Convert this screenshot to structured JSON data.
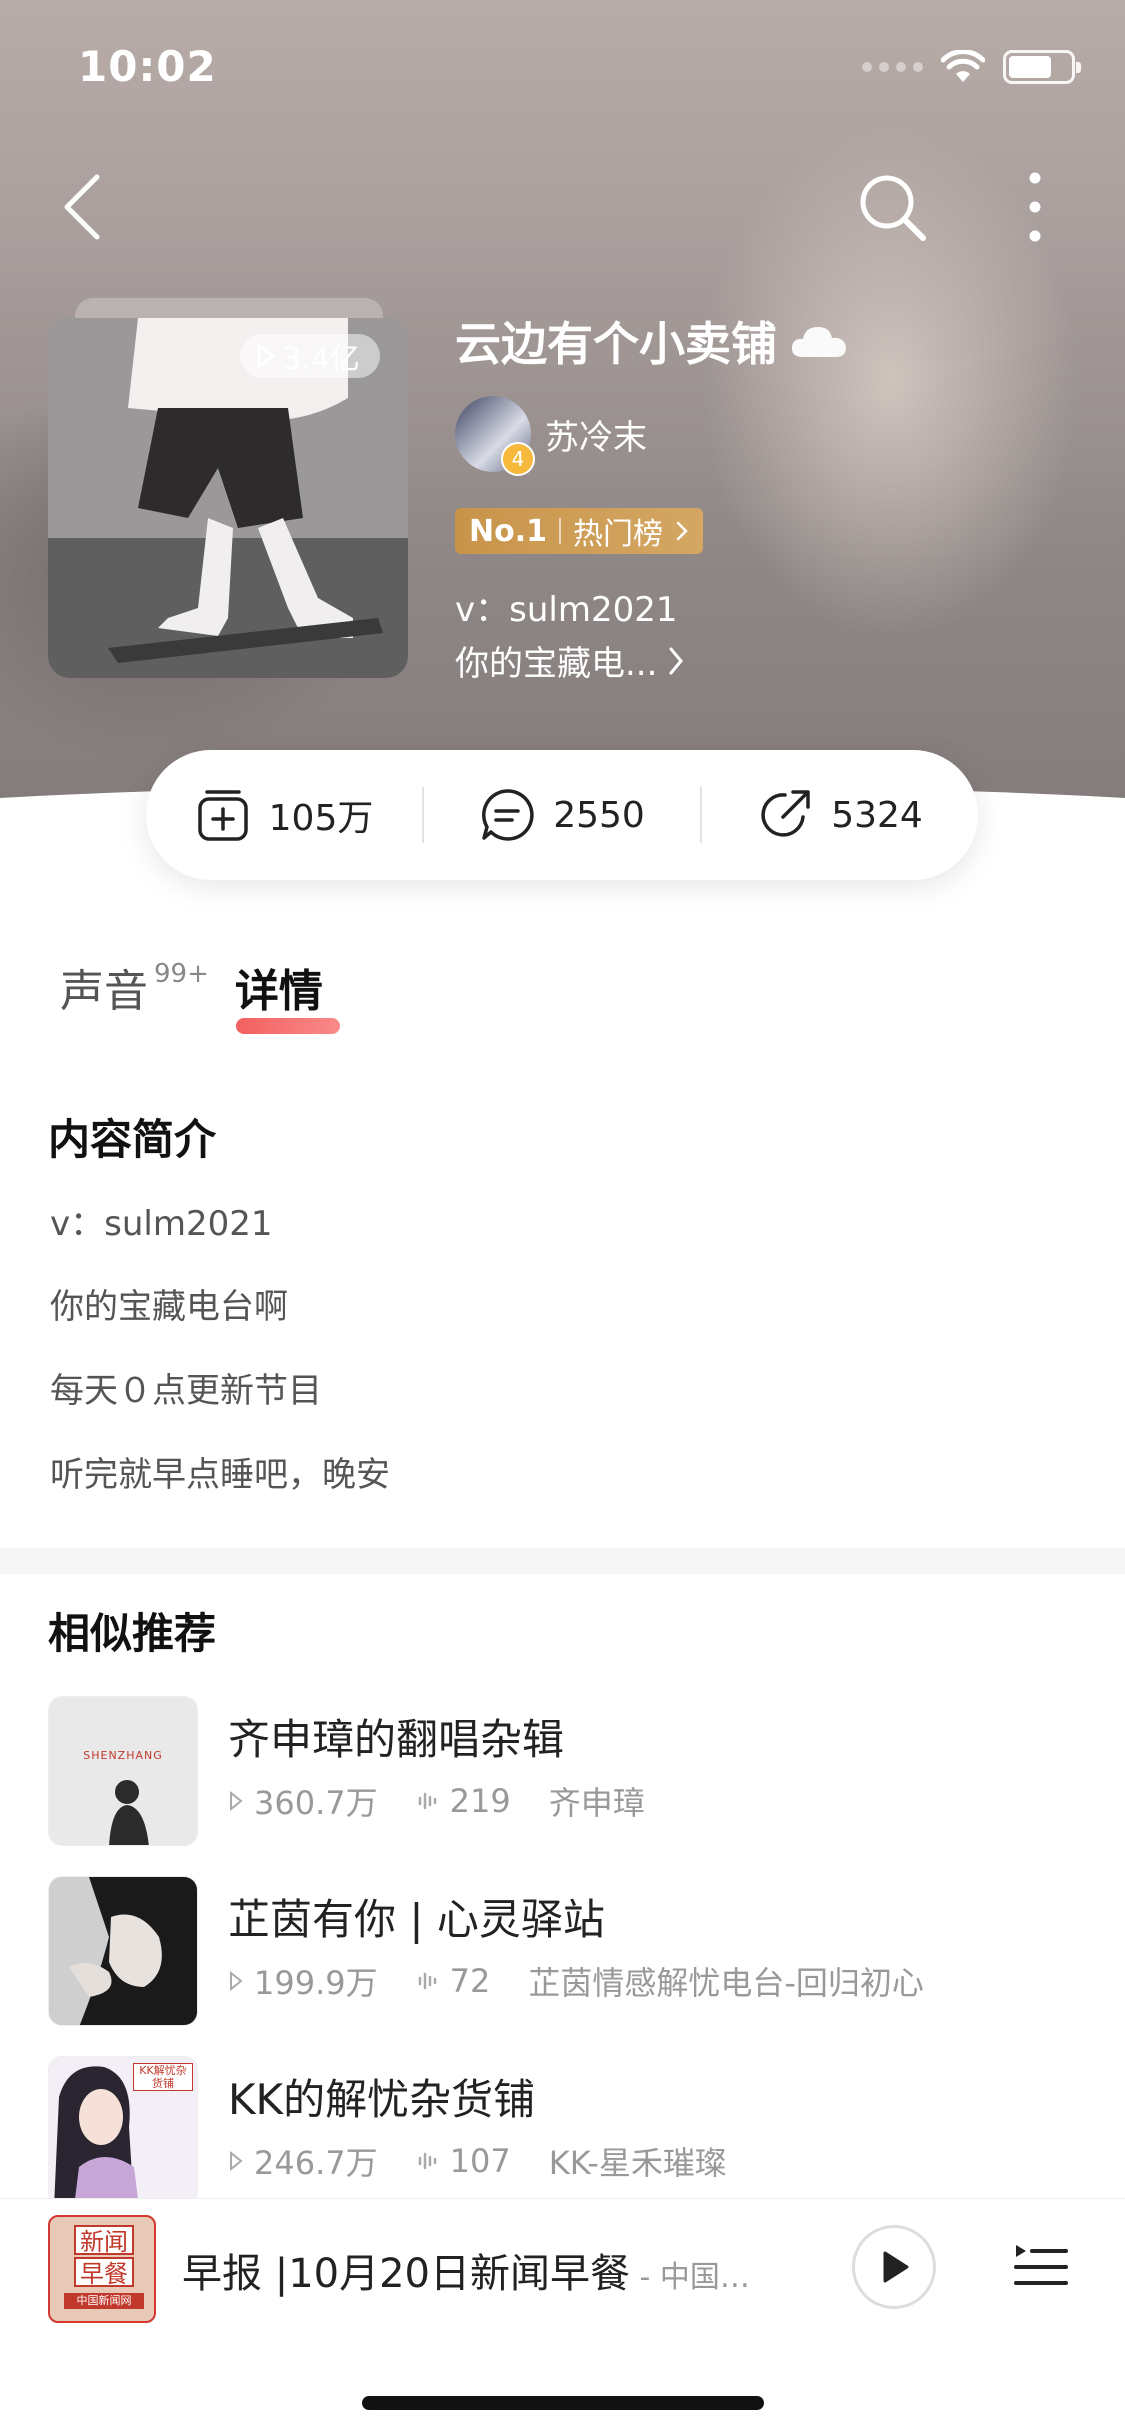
{
  "status_bar": {
    "time": "10:02"
  },
  "album": {
    "title": "云边有个小卖铺",
    "play_count": "3.4亿",
    "author": "苏冷末",
    "author_level": "4",
    "rank_label": "No.1",
    "rank_board": "热门榜",
    "desc_line1": "v：sulm2021",
    "desc_line2": "你的宝藏电..."
  },
  "actions": {
    "subscribe_count": "105万",
    "comment_count": "2550",
    "share_count": "5324"
  },
  "tabs": [
    {
      "label": "声音",
      "count": "99+"
    },
    {
      "label": "详情"
    }
  ],
  "intro": {
    "title": "内容简介",
    "lines": [
      "v：sulm2021",
      "你的宝藏电台啊",
      "每天０点更新节目",
      "听完就早点睡吧，晚安"
    ]
  },
  "recommendations": {
    "title": "相似推荐",
    "items": [
      {
        "title": "齐申璋的翻唱杂辑",
        "plays": "360.7万",
        "tracks": "219",
        "author": "齐申璋",
        "cover_text": "SHENZHANG"
      },
      {
        "title": "芷茵有你 | 心灵驿站",
        "plays": "199.9万",
        "tracks": "72",
        "author": "芷茵情感解忧电台-回归初心",
        "cover_text": ""
      },
      {
        "title": "KK的解忧杂货铺",
        "plays": "246.7万",
        "tracks": "107",
        "author": "KK-星禾璀璨",
        "cover_text": "KK解忧杂货铺"
      }
    ]
  },
  "mini_player": {
    "title": "早报 |10月20日新闻早餐",
    "subtitle": " - 中国…",
    "cover_text_top": "新闻",
    "cover_text_bottom": "早餐",
    "cover_caption": "中国新闻网"
  },
  "colors": {
    "accent_red": "#f46060",
    "rank_gold": "#c8944a"
  }
}
